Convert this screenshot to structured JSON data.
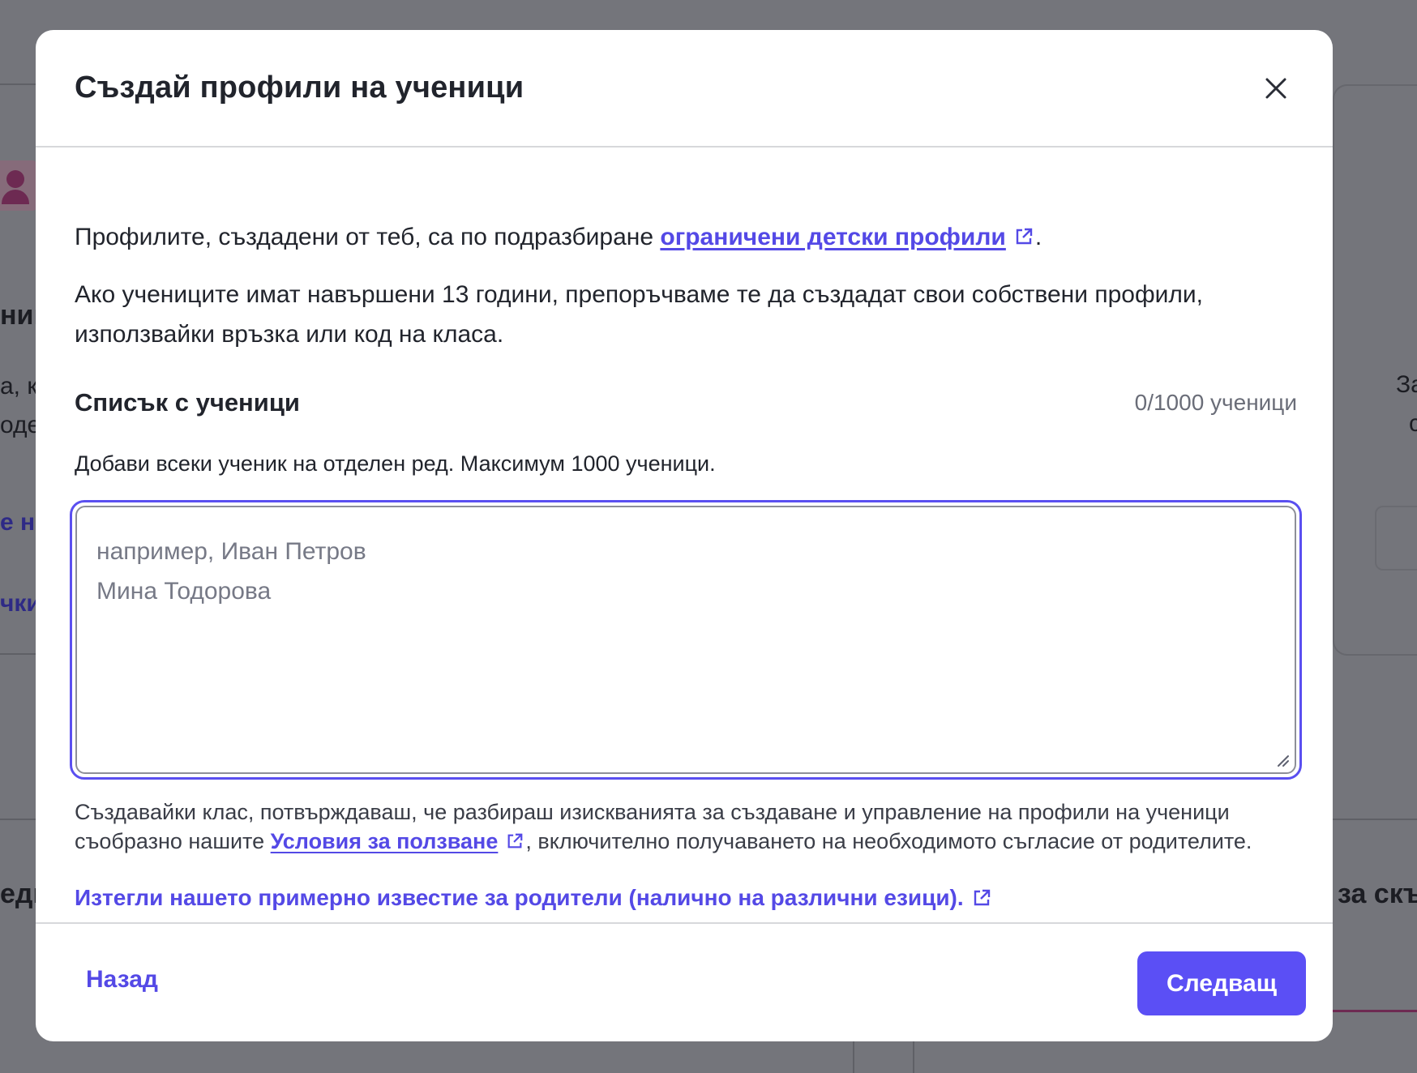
{
  "background": {
    "frag_a": "ниц",
    "frag_b": "а, к",
    "frag_c": "оде",
    "frag_d": "е на",
    "frag_e": "чки",
    "frag_f": "едм",
    "frag_g": "за скъ",
    "frag_h": "За",
    "frag_i": "с"
  },
  "modal": {
    "title": "Създай профили на ученици",
    "close_icon": "close-icon",
    "intro_text": "Профилите, създадени от теб, са по подразбиране ",
    "intro_link": "ограничени детски профили",
    "intro_end": ".",
    "age_line1": "Ако учениците имат навършени 13 години, препоръчваме те да създадат свои собствени профили,",
    "age_line2": "използвайки връзка или код на класа.",
    "list_title": "Списък с ученици",
    "counter": "0/1000 ученици",
    "hint": "Добави всеки ученик на отделен ред. Максимум 1000 ученици.",
    "textarea_value": "",
    "textarea_placeholder": "например, Иван Петров\nМина Тодорова",
    "terms_line1": "Създавайки клас, потвърждаваш, че разбираш изискванията за създаване и управление на профили на ученици",
    "terms_prefix": "съобразно нашите ",
    "terms_link": "Условия за ползване",
    "terms_suffix": ", включително получаването на необходимото съгласие от родителите.",
    "parent_notice_link": "Изтегли нашето примерно известие за родители (налично на различни езици).",
    "back_label": "Назад",
    "next_label": "Следващ",
    "accent_color": "#5449e6"
  }
}
